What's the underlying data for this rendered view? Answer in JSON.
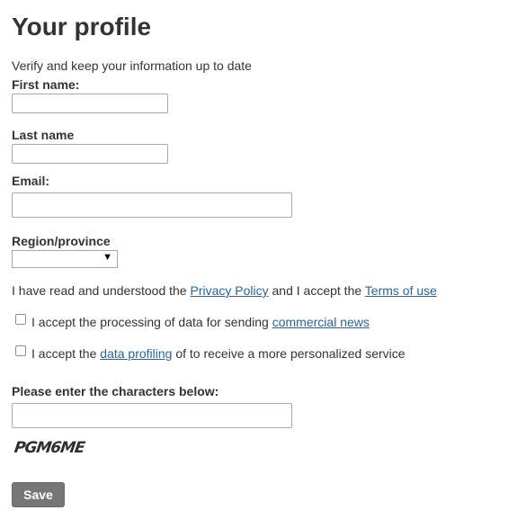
{
  "page": {
    "title": "Your profile",
    "subtitle": "Verify and keep your information up to date"
  },
  "form": {
    "first_name_label": "First name:",
    "first_name_value": "",
    "last_name_label": "Last name",
    "last_name_value": "",
    "email_label": "Email:",
    "email_value": "",
    "region_label": "Region/province",
    "region_selected": "",
    "policy_prefix": "I have read and understood the ",
    "privacy_policy_link": "Privacy Policy",
    "policy_middle": " and I accept the ",
    "terms_link": "Terms of use",
    "checkbox_news_prefix": "I accept the processing of data for sending ",
    "checkbox_news_link": "commercial news",
    "checkbox_news_checked": false,
    "checkbox_profiling_prefix": "I accept the ",
    "checkbox_profiling_link": "data profiling",
    "checkbox_profiling_suffix": " of to receive a more personalized service",
    "checkbox_profiling_checked": false,
    "captcha_label": "Please enter the characters below:",
    "captcha_value": "",
    "captcha_image_text": "PGM6ME",
    "save_label": "Save"
  },
  "colors": {
    "link": "#2a6496",
    "button_bg": "#777777",
    "text": "#333333"
  },
  "icons": {
    "select_caret": "caret-down-icon"
  }
}
